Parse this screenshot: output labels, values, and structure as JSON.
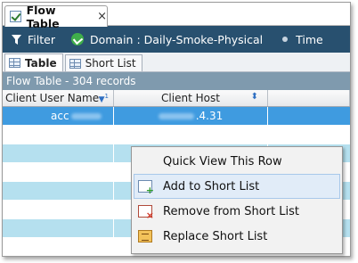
{
  "tab": {
    "title": "Flow Table",
    "close": "×"
  },
  "toolbar": {
    "filter_label": "Filter",
    "domain_label": "Domain : Daily-Smoke-Physical",
    "time_label": "Time"
  },
  "view_tabs": [
    {
      "label": "Table",
      "active": true
    },
    {
      "label": "Short List",
      "active": false
    }
  ],
  "records_label": "Flow Table - 304 records",
  "columns": [
    {
      "label": "Client User Name",
      "sort": "▼",
      "sort_index": "1"
    },
    {
      "label": "Client Host",
      "sort": "⬍"
    }
  ],
  "rows": [
    {
      "user": "acc",
      "host": ".4.31",
      "selected": true
    }
  ],
  "context_menu": {
    "items": [
      {
        "label": "Quick View This Row",
        "icon": "none"
      },
      {
        "label": "Add to Short List",
        "icon": "add-to-list-icon"
      },
      {
        "label": "Remove from Short List",
        "icon": "remove-from-list-icon"
      },
      {
        "label": "Replace Short List",
        "icon": "replace-list-icon"
      }
    ]
  },
  "colors": {
    "toolbar_bg": "#28506f",
    "records_bar_bg": "#7f9aae",
    "selected_row": "#3f9be0",
    "alt_row": "#b5e0ef",
    "menu_hover": "#e1ecf8"
  }
}
